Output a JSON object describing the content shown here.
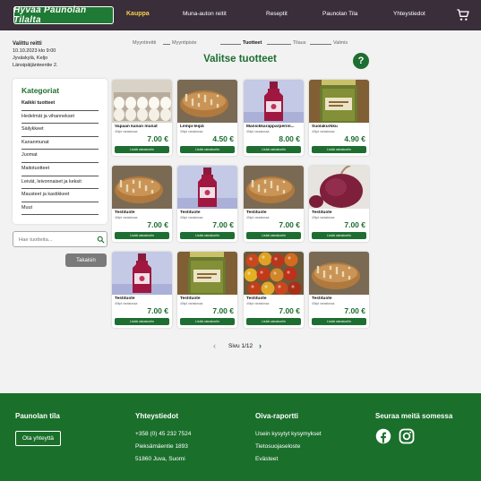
{
  "nav": {
    "logo": "Hyvää Paunolan Tilalta",
    "items": [
      "Kauppa",
      "Muna-auton reitit",
      "Reseptit",
      "Paunolan Tila",
      "Yhteystiedot"
    ]
  },
  "pickup": {
    "title": "Valittu reitti",
    "date": "10.10.2023 klo 9:00",
    "place": "Jyväskylä, Keljo",
    "address": "Länsipäijänteentie 2."
  },
  "stepper": [
    "Myyntireitti",
    "Myyntipiste",
    "Tuotteet",
    "Tilaus",
    "Valmis"
  ],
  "page_title": "Valitse tuotteet",
  "help_label": "?",
  "categories": {
    "title": "Kategoriat",
    "items": [
      "Kaikki tuotteet",
      "Hedelmät ja vihannekset",
      "Säilykkeet",
      "Kananmunat",
      "Juomat",
      "Maitotuotteet",
      "Leivät, leivonnaiset ja keksit",
      "Mausteet ja kastikkeet",
      "Muut"
    ]
  },
  "search": {
    "placeholder": "Hae tuotteita..."
  },
  "back_label": "Takaisin",
  "add_label": "Lisää ostoskoriin",
  "products": [
    {
      "name": "Vapaan kanan munat",
      "stock": "40kpl varastossa",
      "price": "7.00 €",
      "image": "eggs"
    },
    {
      "name": "Lempi-leipä",
      "stock": "30kpl varastossa",
      "price": "4.50 €",
      "image": "bread"
    },
    {
      "name": "Mansikkarapparperim...",
      "stock": "40kpl varastossa",
      "price": "8.00 €",
      "image": "juice"
    },
    {
      "name": "Suolakurkku",
      "stock": "40kpl varastossa",
      "price": "4.90 €",
      "image": "pickles"
    },
    {
      "name": "Testituote",
      "stock": "40kpl varastossa",
      "price": "7.00 €",
      "image": "bread"
    },
    {
      "name": "Testituote",
      "stock": "40kpl varastossa",
      "price": "7.00 €",
      "image": "juice"
    },
    {
      "name": "Testituote",
      "stock": "40kpl varastossa",
      "price": "7.00 €",
      "image": "bread"
    },
    {
      "name": "Testituote",
      "stock": "40kpl varastossa",
      "price": "7.00 €",
      "image": "onion"
    },
    {
      "name": "Testituote",
      "stock": "40kpl varastossa",
      "price": "7.00 €",
      "image": "juice"
    },
    {
      "name": "Testituote",
      "stock": "40kpl varastossa",
      "price": "7.00 €",
      "image": "pickles"
    },
    {
      "name": "Testituote",
      "stock": "40kpl varastossa",
      "price": "7.00 €",
      "image": "tomatoes"
    },
    {
      "name": "Testituote",
      "stock": "40kpl varastossa",
      "price": "7.00 €",
      "image": "bread"
    }
  ],
  "pager": {
    "label": "Sivu 1/12"
  },
  "footer": {
    "col1": {
      "title": "Paunolan tila",
      "button": "Ota yhteyttä"
    },
    "col2": {
      "title": "Yhteystiedot",
      "phone": "+358 (0) 45 232 7524",
      "street": "Pieksämäentie 1893",
      "city": "51860 Juva, Suomi"
    },
    "col3": {
      "title": "Oiva-raportti",
      "faq": "Usein kysytyt kysymykset",
      "privacy": "Tietosuojaseloste",
      "cookies": "Evästeet"
    },
    "col4": {
      "title": "Seuraa meitä somessa"
    }
  },
  "colors": {
    "brand_green": "#1e6e31",
    "nav_bg": "#3a2e3b",
    "nav_active": "#f5d24a",
    "footer_bg": "#1a6f2b"
  }
}
